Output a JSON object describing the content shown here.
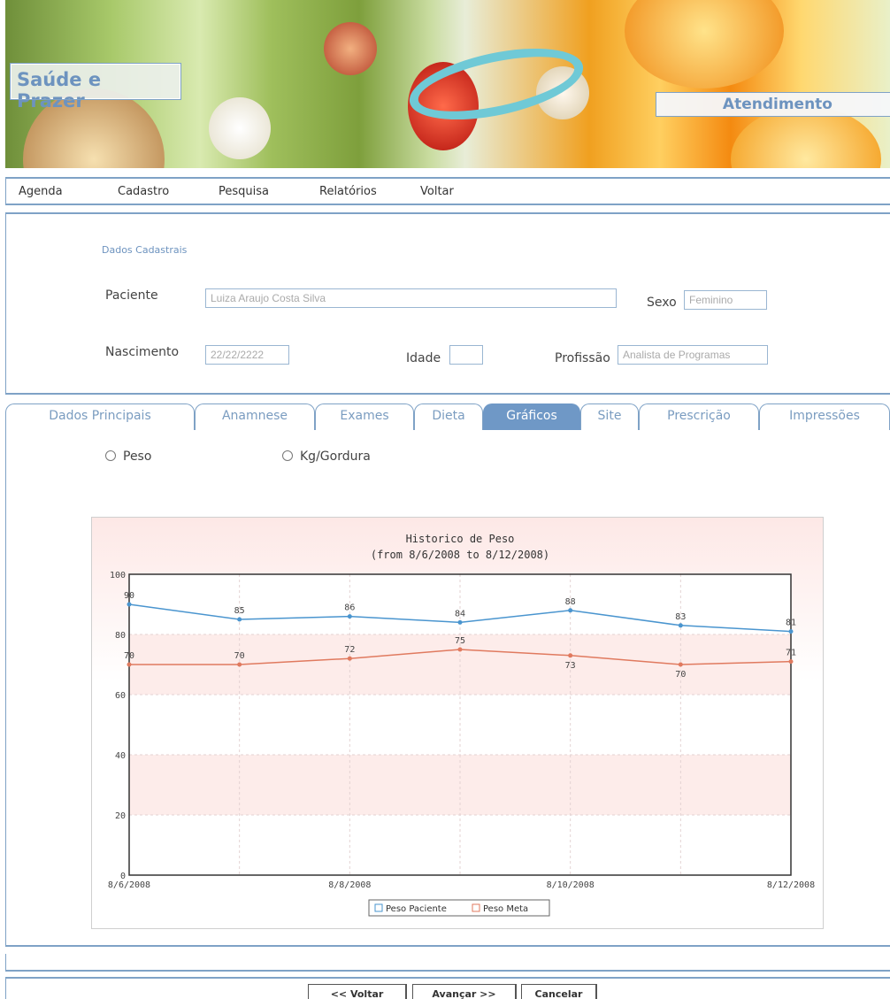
{
  "header": {
    "brand": "Saúde e Prazer",
    "section": "Atendimento"
  },
  "menu": [
    "Agenda",
    "Cadastro",
    "Pesquisa",
    "Relatórios",
    "Voltar"
  ],
  "form": {
    "section_title": "Dados Cadastrais",
    "paciente_label": "Paciente",
    "paciente_value": "Luiza Araujo Costa Silva",
    "sexo_label": "Sexo",
    "sexo_value": "Feminino",
    "nascimento_label": "Nascimento",
    "nascimento_value": "22/22/2222",
    "idade_label": "Idade",
    "idade_value": "",
    "profissao_label": "Profissão",
    "profissao_value": "Analista de Programas"
  },
  "tabs": [
    "Dados Principais",
    "Anamnese",
    "Exames",
    "Dieta",
    "Gráficos",
    "Site",
    "Prescrição",
    "Impressões"
  ],
  "active_tab": "Gráficos",
  "radios": {
    "peso": "Peso",
    "kg_gordura": "Kg/Gordura"
  },
  "chart_data": {
    "type": "line",
    "title": "Historico de Peso",
    "subtitle": "(from 8/6/2008 to 8/12/2008)",
    "x_ticks": [
      "8/6/2008",
      "8/8/2008",
      "8/10/2008",
      "8/12/2008"
    ],
    "ylim": [
      0,
      100
    ],
    "y_ticks": [
      0,
      20,
      40,
      60,
      80,
      100
    ],
    "points": 7,
    "series": [
      {
        "name": "Peso Paciente",
        "color": "#4a95cf",
        "values": [
          90,
          85,
          86,
          84,
          88,
          83,
          81
        ]
      },
      {
        "name": "Peso Meta",
        "color": "#e07a5f",
        "values": [
          70,
          70,
          72,
          75,
          73,
          70,
          71
        ]
      }
    ],
    "grid": true,
    "legend": "bottom"
  },
  "buttons": {
    "voltar": "<< Voltar",
    "avancar": "Avançar >>",
    "cancelar": "Cancelar"
  }
}
